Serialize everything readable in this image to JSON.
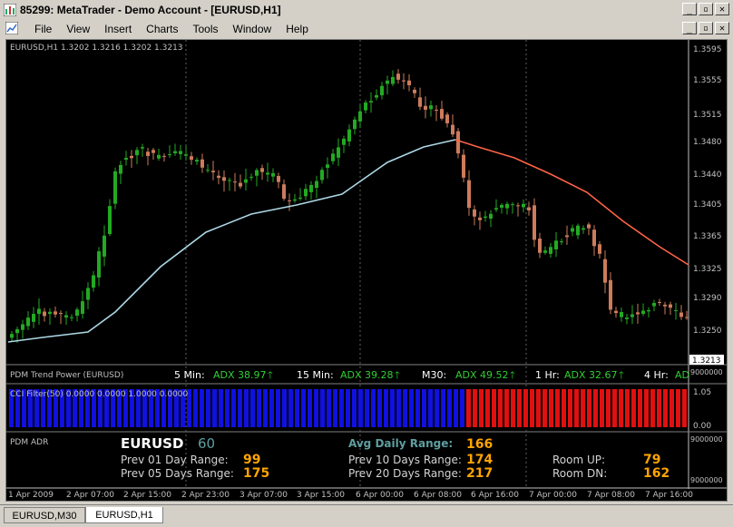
{
  "window": {
    "title": "85299: MetaTrader - Demo Account - [EURUSD,H1]",
    "buttons": [
      "_",
      "▫",
      "✕"
    ],
    "mdi_buttons": [
      "_",
      "▫",
      "✕"
    ]
  },
  "menu": [
    "File",
    "View",
    "Insert",
    "Charts",
    "Tools",
    "Window",
    "Help"
  ],
  "chart": {
    "info": "EURUSD,H1  1.3202 1.3216 1.3202 1.3213",
    "current_price": "1.3213",
    "price_labels": [
      "1.3595",
      "1.3555",
      "1.3515",
      "1.3480",
      "1.3440",
      "1.3405",
      "1.3365",
      "1.3325",
      "1.3290",
      "1.3250"
    ],
    "time_labels": [
      "1 Apr 2009",
      "2 Apr 07:00",
      "2 Apr 15:00",
      "2 Apr 23:00",
      "3 Apr 07:00",
      "3 Apr 15:00",
      "6 Apr 00:00",
      "6 Apr 08:00",
      "6 Apr 16:00",
      "7 Apr 00:00",
      "7 Apr 08:00",
      "7 Apr 16:00"
    ],
    "colors": {
      "bull": "#22aa22",
      "bear": "#cd7b5b",
      "ma_up": "#add8e6",
      "ma_down": "#ff6347"
    }
  },
  "trend": {
    "name": "PDM Trend Power (EURUSD)",
    "items": [
      {
        "tf": "5 Min:",
        "val": "ADX 38.97"
      },
      {
        "tf": "15 Min:",
        "val": "ADX 39.28"
      },
      {
        "tf": "M30:",
        "val": "ADX 49.52"
      },
      {
        "tf": "1 Hr:",
        "val": "ADX 32.67"
      },
      {
        "tf": "4 Hr:",
        "val": "AD"
      }
    ],
    "arrow": "🡑",
    "scale_label": "9000000"
  },
  "cci": {
    "name": "CCI Filter(50) 0.0000 0.0000 1.0000 0.0000",
    "scale": [
      "1.05",
      "0.00"
    ]
  },
  "adr": {
    "name": "PDM ADR",
    "symbol": "EURUSD",
    "symbol_value": "60",
    "rows_left": [
      {
        "label": "Prev 01 Day Range:",
        "val": "99"
      },
      {
        "label": "Prev 05 Days Range:",
        "val": "175"
      }
    ],
    "avg_label": "Avg Daily Range:",
    "avg_val": "166",
    "rows_mid": [
      {
        "label": "Prev 10 Days Range:",
        "val": "174"
      },
      {
        "label": "Prev 20 Days Range:",
        "val": "217"
      }
    ],
    "rows_right": [
      {
        "label": "Room UP:",
        "val": "79"
      },
      {
        "label": "Room DN:",
        "val": "162"
      }
    ],
    "scale": [
      "9000000",
      "9000000"
    ]
  },
  "tabs": [
    {
      "label": "EURUSD,M30",
      "active": false
    },
    {
      "label": "EURUSD,H1",
      "active": true
    }
  ]
}
